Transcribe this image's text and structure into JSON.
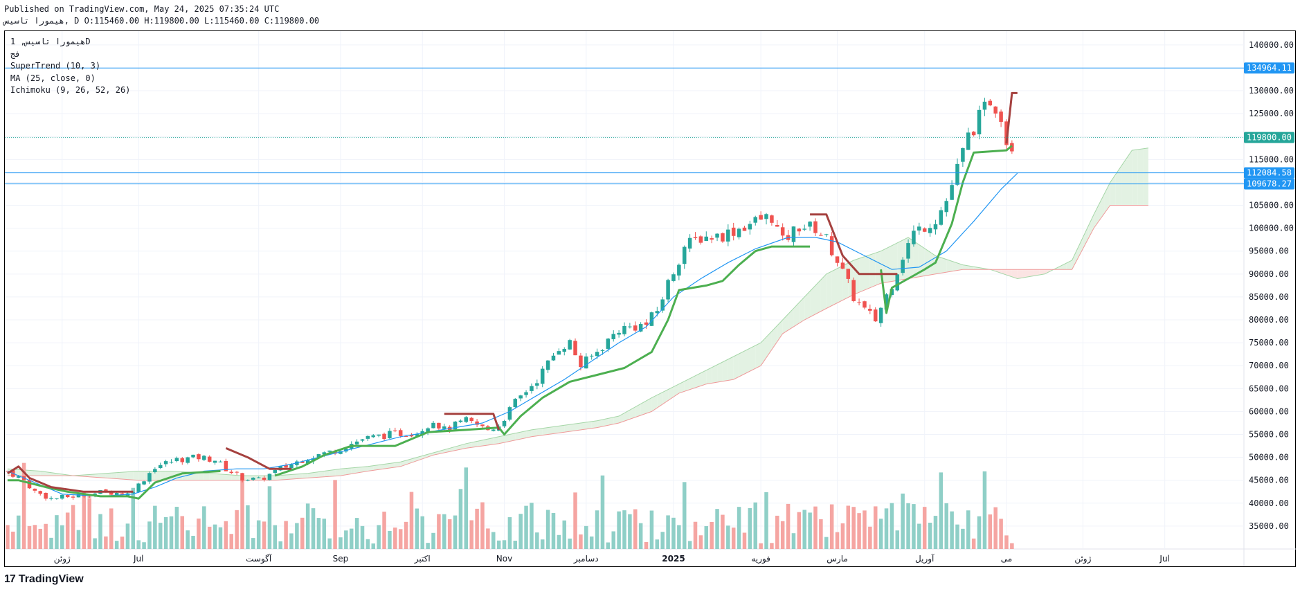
{
  "header": {
    "published_line": "Published on TradingView.com, May 24, 2025 07:35:24 UTC",
    "ohlc_line": "هیمورا تاسیس, D O:115460.00 H:119800.00 L:115460.00 C:119800.00"
  },
  "legend": {
    "symbol_interval": "هیمورا تاسیس, 1D",
    "exchange": "فج",
    "indicator_1": "SuperTrend (10, 3)",
    "indicator_2": "MA (25, close, 0)",
    "indicator_3": "Ichimoku (9, 26, 52, 26)"
  },
  "footer": {
    "logo_mark": "17",
    "brand": "TradingView"
  },
  "colors": {
    "up": "#26a69a",
    "down": "#ef5350",
    "up_vol": "#8fcfc7",
    "down_vol": "#f5a5a2",
    "supertrend_up": "#4caf50",
    "supertrend_down": "#a5413f",
    "ma": "#2196f3",
    "hline": "#2196f3",
    "cloud_bull": "#e3f2e3",
    "cloud_bear": "#fbe4e3",
    "last_price": "#26a69a"
  },
  "chart_data": {
    "type": "candlestick",
    "interval": "1D",
    "y_axis": {
      "ylim": [
        30000,
        143000
      ],
      "ticks": [
        35000,
        40000,
        45000,
        50000,
        55000,
        60000,
        65000,
        70000,
        75000,
        80000,
        85000,
        90000,
        95000,
        100000,
        105000,
        110000,
        115000,
        120000,
        125000,
        130000,
        135000,
        140000
      ],
      "tick_labels": [
        "35000.00",
        "40000.00",
        "45000.00",
        "50000.00",
        "55000.00",
        "60000.00",
        "65000.00",
        "70000.00",
        "75000.00",
        "80000.00",
        "85000.00",
        "90000.00",
        "95000.00",
        "100000.00",
        "105000.00",
        "110000.00",
        "115000.00",
        "120000.00",
        "125000.00",
        "130000.00",
        "135000.00",
        "140000.00"
      ]
    },
    "x_axis": {
      "labels": [
        "ژوئن",
        "Jul",
        "آگوست",
        "Sep",
        "اکتبر",
        "Nov",
        "دسامبر",
        "2025",
        "فوریه",
        "مارس",
        "آوریل",
        "می",
        "ژوئن",
        "Jul"
      ],
      "label_bars": [
        10,
        24,
        46,
        61,
        76,
        91,
        106,
        122,
        138,
        152,
        168,
        183,
        197,
        212
      ],
      "bold_label": "2025",
      "total_bars": 227,
      "last_price_bar": 180
    },
    "horizontal_lines": [
      {
        "value": 134964.11,
        "label": "134964.11"
      },
      {
        "value": 112084.58,
        "label": "112084.58"
      },
      {
        "value": 109678.27,
        "label": "109678.27"
      }
    ],
    "last_price": {
      "value": 119800.0,
      "label": "119800.00"
    },
    "price_anchors": [
      [
        0,
        47000
      ],
      [
        3,
        45000
      ],
      [
        5,
        42500
      ],
      [
        8,
        41000
      ],
      [
        12,
        41500
      ],
      [
        18,
        42500
      ],
      [
        22,
        42000
      ],
      [
        24,
        44000
      ],
      [
        27,
        48000
      ],
      [
        31,
        49500
      ],
      [
        35,
        50000
      ],
      [
        38,
        49500
      ],
      [
        40,
        47500
      ],
      [
        43,
        45500
      ],
      [
        46,
        45000
      ],
      [
        50,
        47500
      ],
      [
        55,
        50000
      ],
      [
        60,
        51500
      ],
      [
        65,
        54000
      ],
      [
        70,
        55000
      ],
      [
        75,
        55500
      ],
      [
        78,
        58000
      ],
      [
        80,
        56000
      ],
      [
        84,
        58000
      ],
      [
        88,
        56000
      ],
      [
        90,
        57000
      ],
      [
        93,
        62000
      ],
      [
        97,
        67000
      ],
      [
        101,
        74000
      ],
      [
        103,
        75000
      ],
      [
        105,
        70000
      ],
      [
        108,
        73000
      ],
      [
        112,
        78000
      ],
      [
        117,
        79000
      ],
      [
        119,
        82000
      ],
      [
        121,
        88000
      ],
      [
        124,
        96000
      ],
      [
        127,
        98000
      ],
      [
        131,
        98500
      ],
      [
        134,
        100000
      ],
      [
        138,
        102000
      ],
      [
        140,
        102500
      ],
      [
        142,
        97000
      ],
      [
        145,
        100500
      ],
      [
        148,
        100000
      ],
      [
        150,
        97500
      ],
      [
        152,
        93000
      ],
      [
        155,
        85000
      ],
      [
        157,
        82000
      ],
      [
        159,
        80000
      ],
      [
        162,
        88000
      ],
      [
        164,
        94000
      ],
      [
        166,
        99000
      ],
      [
        170,
        102000
      ],
      [
        172,
        106000
      ],
      [
        174,
        113000
      ],
      [
        176,
        120000
      ],
      [
        178,
        124000
      ],
      [
        180,
        128000
      ],
      [
        182,
        125000
      ],
      [
        183,
        119000
      ],
      [
        184,
        118000
      ]
    ],
    "volume_bars": 185,
    "supertrend_up": [
      [
        0,
        45000
      ],
      [
        2,
        45000
      ],
      [
        7,
        43500
      ],
      [
        11,
        42500
      ],
      [
        17,
        41500
      ],
      [
        22,
        41500
      ],
      [
        24,
        41000
      ],
      [
        27,
        44500
      ],
      [
        32,
        46500
      ],
      [
        39,
        47000
      ],
      null,
      [
        49,
        46000
      ],
      [
        54,
        48000
      ],
      [
        58,
        50500
      ],
      [
        63,
        52500
      ],
      [
        71,
        52500
      ],
      [
        77,
        55500
      ],
      [
        84,
        56000
      ],
      [
        90,
        56500
      ],
      [
        91,
        55000
      ],
      [
        94,
        59000
      ],
      [
        98,
        63000
      ],
      [
        103,
        66500
      ],
      [
        108,
        68000
      ],
      [
        113,
        69500
      ],
      [
        118,
        73000
      ],
      [
        121,
        80000
      ],
      [
        123,
        86500
      ],
      [
        128,
        87500
      ],
      [
        131,
        88500
      ],
      [
        134,
        92000
      ],
      [
        137,
        95000
      ],
      [
        140,
        96000
      ],
      [
        147,
        96000
      ],
      null,
      [
        160,
        91000
      ],
      [
        161,
        81500
      ],
      [
        162,
        87000
      ],
      [
        165,
        89000
      ],
      [
        168,
        91000
      ],
      [
        170,
        92500
      ],
      [
        173,
        101000
      ],
      [
        175,
        110000
      ],
      [
        177,
        116500
      ],
      [
        183,
        117000
      ],
      [
        184,
        118000
      ]
    ],
    "supertrend_down": [
      [
        0,
        46500
      ],
      [
        2,
        48000
      ],
      [
        4,
        45500
      ],
      [
        8,
        43500
      ],
      [
        14,
        42500
      ],
      [
        23,
        42500
      ],
      null,
      [
        40,
        52000
      ],
      [
        44,
        50000
      ],
      [
        48,
        47500
      ],
      [
        52,
        47500
      ],
      null,
      [
        80,
        59500
      ],
      [
        89,
        59500
      ],
      [
        90,
        56000
      ],
      null,
      [
        147,
        103000
      ],
      [
        150,
        103000
      ],
      [
        153,
        94000
      ],
      [
        156,
        90000
      ],
      [
        159,
        90000
      ],
      [
        163,
        90000
      ],
      null,
      [
        183,
        118500
      ],
      [
        184,
        129500
      ],
      [
        185,
        129500
      ]
    ],
    "ma_25": [
      [
        0,
        47000
      ],
      [
        5,
        44500
      ],
      [
        10,
        42000
      ],
      [
        17,
        41500
      ],
      [
        23,
        42000
      ],
      [
        27,
        43500
      ],
      [
        31,
        45500
      ],
      [
        36,
        47000
      ],
      [
        42,
        47500
      ],
      [
        47,
        47500
      ],
      [
        52,
        48500
      ],
      [
        57,
        50000
      ],
      [
        62,
        51500
      ],
      [
        67,
        53000
      ],
      [
        72,
        54500
      ],
      [
        77,
        55500
      ],
      [
        82,
        56500
      ],
      [
        87,
        57500
      ],
      [
        92,
        60000
      ],
      [
        97,
        63500
      ],
      [
        102,
        67000
      ],
      [
        107,
        71000
      ],
      [
        112,
        75000
      ],
      [
        117,
        78500
      ],
      [
        122,
        85000
      ],
      [
        127,
        89000
      ],
      [
        132,
        92500
      ],
      [
        137,
        95500
      ],
      [
        143,
        98000
      ],
      [
        148,
        98000
      ],
      [
        152,
        97000
      ],
      [
        157,
        94000
      ],
      [
        162,
        91000
      ],
      [
        167,
        91500
      ],
      [
        172,
        95000
      ],
      [
        177,
        101500
      ],
      [
        182,
        108500
      ],
      [
        185,
        112000
      ]
    ],
    "span_a": [
      [
        0,
        47500
      ],
      [
        6,
        47000
      ],
      [
        12,
        46000
      ],
      [
        18,
        46500
      ],
      [
        24,
        47000
      ],
      [
        30,
        47000
      ],
      [
        37,
        46500
      ],
      [
        43,
        46000
      ],
      [
        49,
        46000
      ],
      [
        55,
        46500
      ],
      [
        61,
        47500
      ],
      [
        66,
        48000
      ],
      [
        72,
        49000
      ],
      [
        78,
        51000
      ],
      [
        84,
        53000
      ],
      [
        90,
        54500
      ],
      [
        96,
        56000
      ],
      [
        102,
        57000
      ],
      [
        108,
        58000
      ],
      [
        112,
        59000
      ],
      [
        118,
        63000
      ],
      [
        123,
        66000
      ],
      [
        128,
        69000
      ],
      [
        133,
        72000
      ],
      [
        138,
        75000
      ],
      [
        142,
        80000
      ],
      [
        146,
        85000
      ],
      [
        150,
        90000
      ],
      [
        155,
        93000
      ],
      [
        160,
        95000
      ],
      [
        165,
        98000
      ],
      [
        170,
        94000
      ],
      [
        175,
        92000
      ],
      [
        180,
        91000
      ],
      [
        185,
        89000
      ],
      [
        190,
        90000
      ],
      [
        195,
        93000
      ],
      [
        199,
        103000
      ],
      [
        202,
        110000
      ],
      [
        206,
        117000
      ],
      [
        209,
        117500
      ]
    ],
    "span_b": [
      [
        0,
        46000
      ],
      [
        6,
        46000
      ],
      [
        12,
        46000
      ],
      [
        18,
        45500
      ],
      [
        24,
        45000
      ],
      [
        30,
        45000
      ],
      [
        37,
        45000
      ],
      [
        43,
        45000
      ],
      [
        49,
        45000
      ],
      [
        55,
        45500
      ],
      [
        61,
        46000
      ],
      [
        66,
        47000
      ],
      [
        72,
        48000
      ],
      [
        78,
        50500
      ],
      [
        84,
        52000
      ],
      [
        90,
        53000
      ],
      [
        96,
        54500
      ],
      [
        102,
        55500
      ],
      [
        108,
        56500
      ],
      [
        112,
        57500
      ],
      [
        118,
        60000
      ],
      [
        123,
        64000
      ],
      [
        128,
        66000
      ],
      [
        133,
        67000
      ],
      [
        138,
        70000
      ],
      [
        142,
        77000
      ],
      [
        146,
        80000
      ],
      [
        150,
        82500
      ],
      [
        155,
        85500
      ],
      [
        160,
        88000
      ],
      [
        165,
        89000
      ],
      [
        170,
        90000
      ],
      [
        175,
        91000
      ],
      [
        180,
        91000
      ],
      [
        185,
        91000
      ],
      [
        190,
        91000
      ],
      [
        195,
        91000
      ],
      [
        199,
        100000
      ],
      [
        202,
        105000
      ],
      [
        206,
        105000
      ],
      [
        209,
        105000
      ]
    ]
  }
}
